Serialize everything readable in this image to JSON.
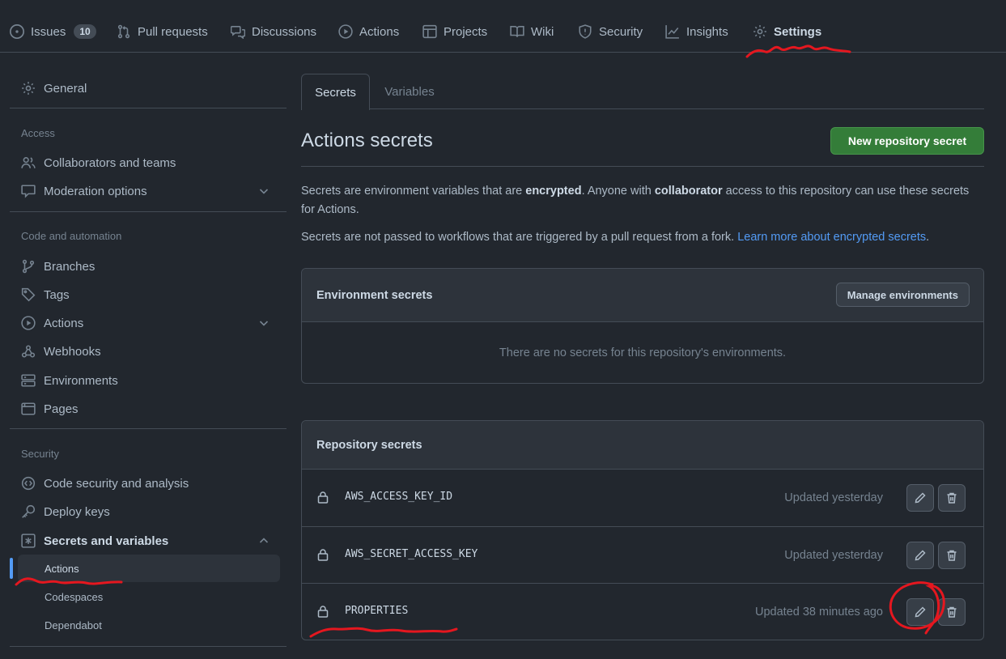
{
  "topnav": {
    "tabs": [
      {
        "label": "Issues",
        "count": "10",
        "icon": "issue-opened-icon"
      },
      {
        "label": "Pull requests",
        "icon": "git-pull-request-icon"
      },
      {
        "label": "Discussions",
        "icon": "comment-discussion-icon"
      },
      {
        "label": "Actions",
        "icon": "play-icon"
      },
      {
        "label": "Projects",
        "icon": "table-icon"
      },
      {
        "label": "Wiki",
        "icon": "book-icon"
      },
      {
        "label": "Security",
        "icon": "shield-icon"
      },
      {
        "label": "Insights",
        "icon": "graph-icon"
      },
      {
        "label": "Settings",
        "icon": "gear-icon",
        "selected": true
      }
    ]
  },
  "sidebar": {
    "general": "General",
    "access_heading": "Access",
    "collaborators": "Collaborators and teams",
    "moderation": "Moderation options",
    "code_heading": "Code and automation",
    "branches": "Branches",
    "tags": "Tags",
    "actions": "Actions",
    "webhooks": "Webhooks",
    "environments": "Environments",
    "pages": "Pages",
    "security_heading": "Security",
    "code_security": "Code security and analysis",
    "deploy_keys": "Deploy keys",
    "secrets_and_variables": "Secrets and variables",
    "sub_actions": "Actions",
    "sub_codespaces": "Codespaces",
    "sub_dependabot": "Dependabot"
  },
  "main": {
    "tabs": {
      "secrets": "Secrets",
      "variables": "Variables"
    },
    "title": "Actions secrets",
    "new_secret_button": "New repository secret",
    "intro": {
      "p1_a": "Secrets are environment variables that are ",
      "p1_b": "encrypted",
      "p1_c": ". Anyone with ",
      "p1_d": "collaborator",
      "p1_e": " access to this repository can use these secrets for Actions.",
      "p2_a": "Secrets are not passed to workflows that are triggered by a pull request from a fork. ",
      "p2_link": "Learn more about encrypted secrets",
      "p2_end": "."
    },
    "env_secrets": {
      "title": "Environment secrets",
      "manage_button": "Manage environments",
      "empty_text": "There are no secrets for this repository's environments."
    },
    "repo_secrets": {
      "title": "Repository secrets",
      "rows": [
        {
          "name": "AWS_ACCESS_KEY_ID",
          "updated": "Updated yesterday"
        },
        {
          "name": "AWS_SECRET_ACCESS_KEY",
          "updated": "Updated yesterday"
        },
        {
          "name": "PROPERTIES",
          "updated": "Updated 38 minutes ago"
        }
      ]
    }
  },
  "colors": {
    "background": "#22272e",
    "border": "#444c56",
    "accent_blue": "#539bf5",
    "button_green": "#347d39",
    "annotation_red": "#e5171f"
  }
}
